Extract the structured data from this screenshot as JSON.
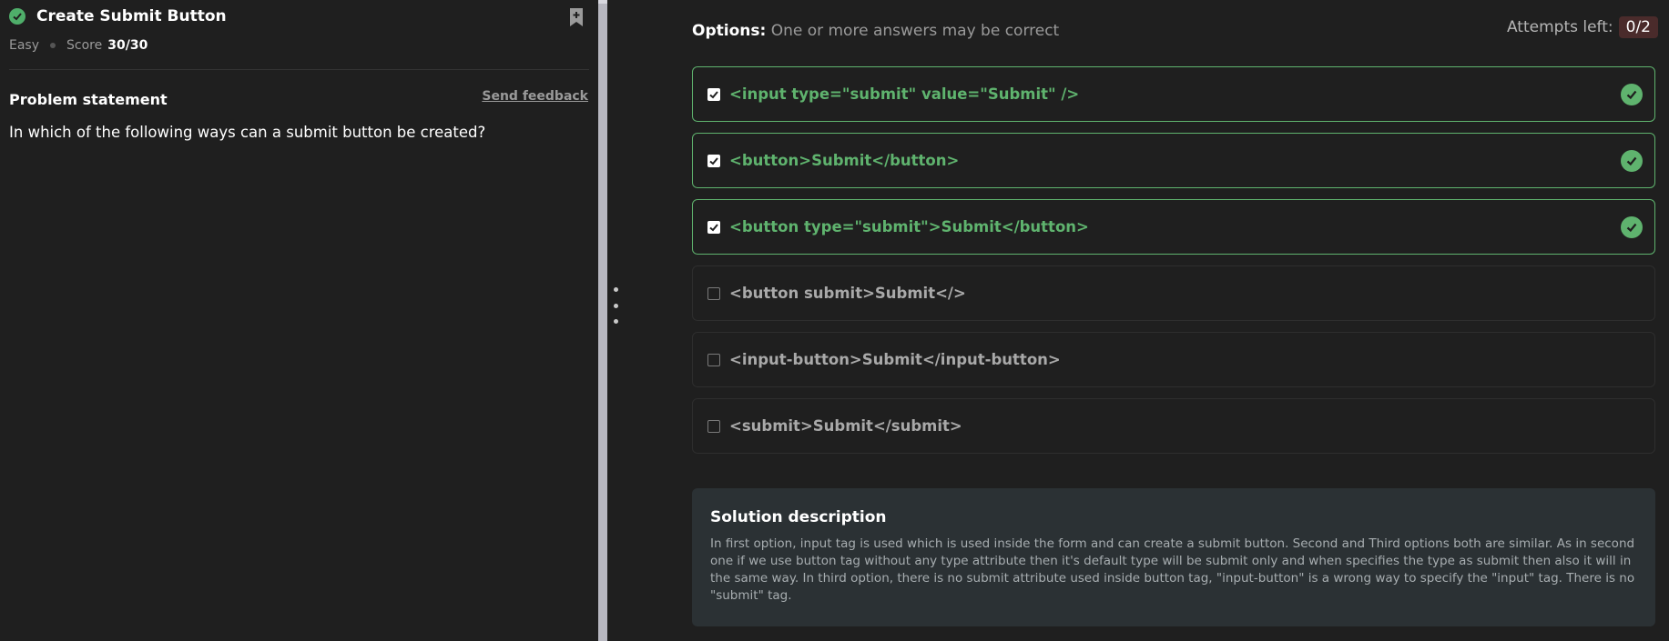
{
  "problem": {
    "title": "Create Submit Button",
    "difficulty": "Easy",
    "score_label": "Score",
    "score_value": "30/30",
    "statement_heading": "Problem statement",
    "feedback_link": "Send feedback",
    "question": "In which of the following ways can a submit button be created?"
  },
  "options_header": {
    "label": "Options:",
    "note": "One or more answers may be correct"
  },
  "attempts": {
    "label": "Attempts left:",
    "value": "0/2"
  },
  "options": [
    {
      "text": "<input type=\"submit\" value=\"Submit\" />",
      "checked": true,
      "correct": true
    },
    {
      "text": "<button>Submit</button>",
      "checked": true,
      "correct": true
    },
    {
      "text": "<button type=\"submit\">Submit</button>",
      "checked": true,
      "correct": true
    },
    {
      "text": "<button submit>Submit</>",
      "checked": false,
      "correct": false
    },
    {
      "text": "<input-button>Submit</input-button>",
      "checked": false,
      "correct": false
    },
    {
      "text": "<submit>Submit</submit>",
      "checked": false,
      "correct": false
    }
  ],
  "solution": {
    "heading": "Solution description",
    "body": "In first option, input tag is used which is used inside the form and can create a submit button. Second and Third options both are similar. As in second one if we use button tag without any type attribute then it's default type will be submit only and when specifies the type as submit then also it will in the same way. In third option, there is no submit attribute used inside button tag, \"input-button\" is a wrong way to specify the \"input\" tag. There is no \"submit\" tag."
  },
  "colors": {
    "background": "#1f1f1f",
    "correct_green": "#5fb36e",
    "solution_bg": "#2b3134",
    "attempts_badge": "#4a2b2b"
  },
  "icons": {
    "solved": "check-circle-icon",
    "bookmark": "bookmark-add-icon",
    "option_correct": "check-circle-icon",
    "resize": "drag-handle-icon"
  }
}
